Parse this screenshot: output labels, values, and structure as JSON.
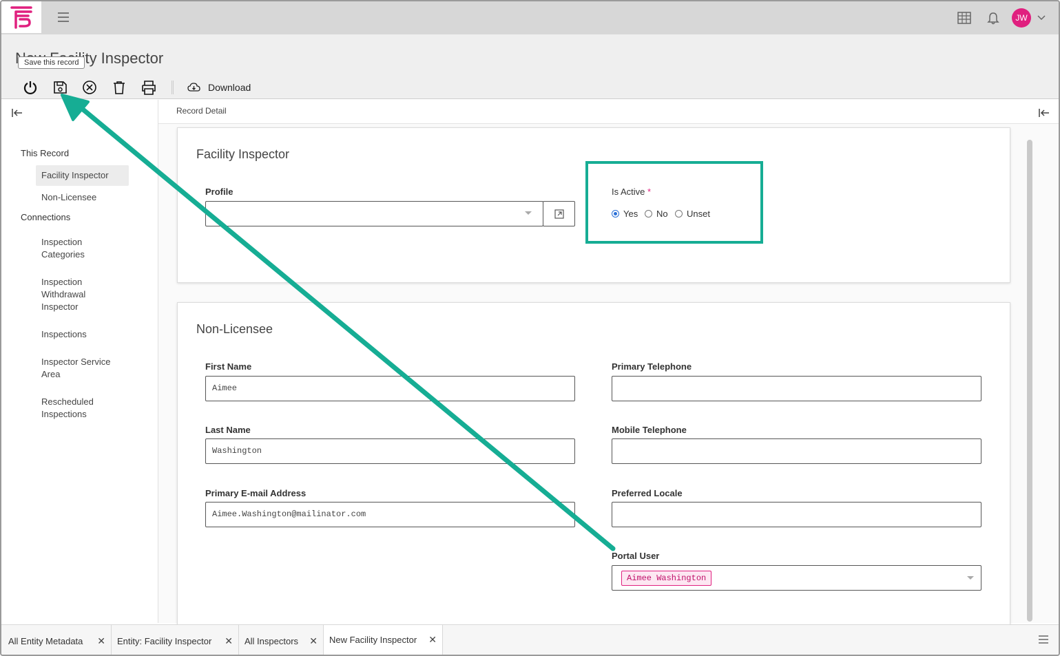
{
  "app": {
    "avatar_initials": "JW",
    "brand_color": "#e0207f"
  },
  "header": {
    "title": "New Facility Inspector",
    "tooltip": "Save this record",
    "download_label": "Download"
  },
  "sidebar": {
    "section_this_record": "This Record",
    "this_record_items": [
      "Facility Inspector",
      "Non-Licensee"
    ],
    "section_connections": "Connections",
    "connection_items": [
      "Inspection Categories",
      "Inspection Withdrawal Inspector",
      "Inspections",
      "Inspector Service Area",
      "Rescheduled Inspections"
    ]
  },
  "main": {
    "breadcrumb": "Record Detail",
    "facility_card": {
      "title": "Facility Inspector",
      "profile_label": "Profile",
      "profile_value": "",
      "is_active_label": "Is Active",
      "required_mark": "*",
      "radio_options": [
        "Yes",
        "No",
        "Unset"
      ],
      "selected": "Yes"
    },
    "nonlicensee_card": {
      "title": "Non-Licensee",
      "first_name_label": "First Name",
      "first_name_value": "Aimee",
      "last_name_label": "Last Name",
      "last_name_value": "Washington",
      "email_label": "Primary E-mail Address",
      "email_value": "Aimee.Washington@mailinator.com",
      "primary_phone_label": "Primary Telephone",
      "primary_phone_value": "",
      "mobile_phone_label": "Mobile Telephone",
      "mobile_phone_value": "",
      "locale_label": "Preferred Locale",
      "locale_value": "",
      "portal_user_label": "Portal User",
      "portal_user_value": "Aimee Washington"
    }
  },
  "tabs": [
    "All Entity Metadata",
    "Entity: Facility Inspector",
    "All Inspectors",
    "New Facility Inspector"
  ],
  "annotation": {
    "color": "#16ad94"
  }
}
